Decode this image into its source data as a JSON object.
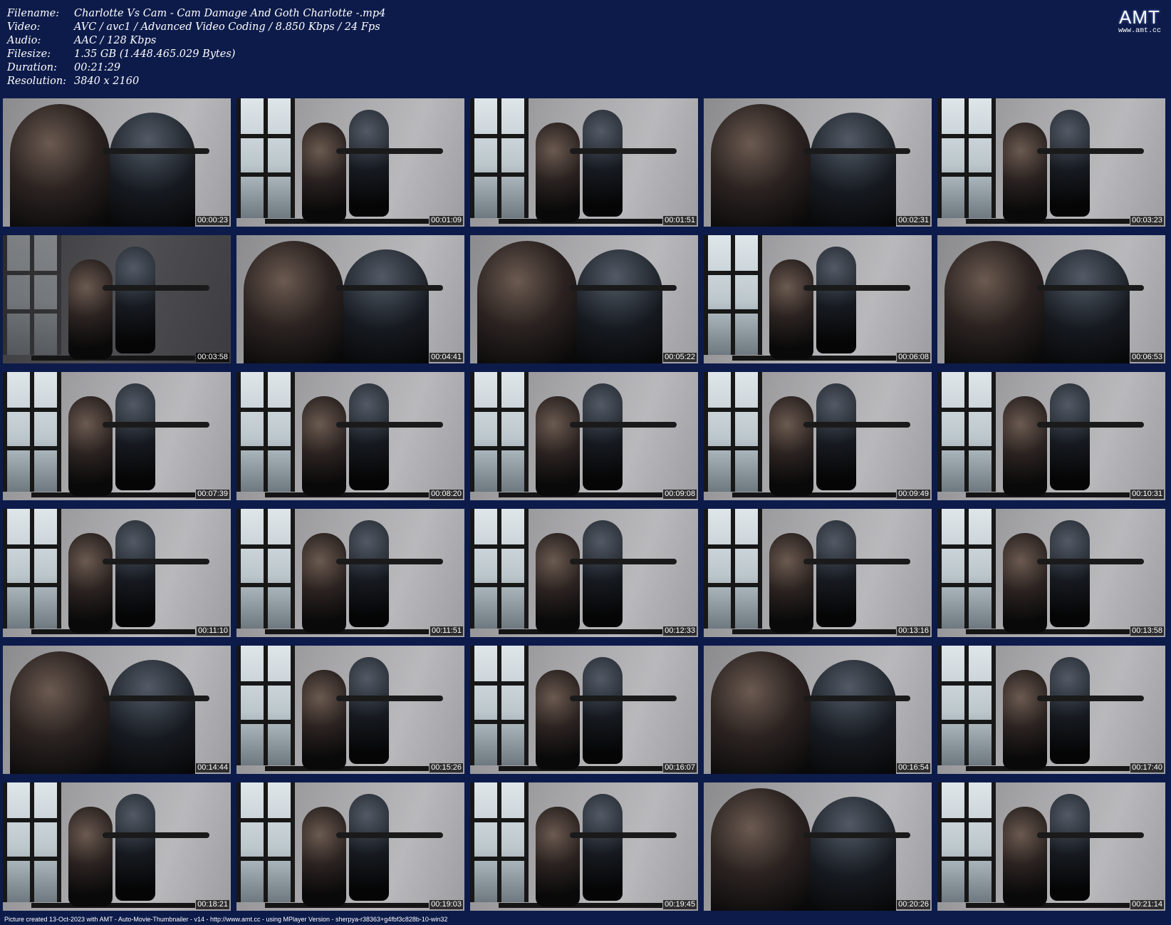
{
  "info": [
    {
      "key": "Filename:",
      "value": "Charlotte Vs Cam - Cam Damage And Goth Charlotte -.mp4"
    },
    {
      "key": "Video:",
      "value": "AVC / avc1 / Advanced Video Coding / 8.850 Kbps / 24 Fps"
    },
    {
      "key": "Audio:",
      "value": "AAC / 128 Kbps"
    },
    {
      "key": "Filesize:",
      "value": "1.35 GB (1.448.465.029 Bytes)"
    },
    {
      "key": "Duration:",
      "value": "00:21:29"
    },
    {
      "key": "Resolution:",
      "value": "3840 x 2160"
    }
  ],
  "logo": {
    "main": "AMT",
    "sub": "www.amt.cc"
  },
  "thumbnails": [
    {
      "time": "00:00:23",
      "style": "closeup"
    },
    {
      "time": "00:01:09",
      "style": "wide"
    },
    {
      "time": "00:01:51",
      "style": "wide"
    },
    {
      "time": "00:02:31",
      "style": "closeup"
    },
    {
      "time": "00:03:23",
      "style": "wide"
    },
    {
      "time": "00:03:58",
      "style": "dark"
    },
    {
      "time": "00:04:41",
      "style": "closeup"
    },
    {
      "time": "00:05:22",
      "style": "closeup"
    },
    {
      "time": "00:06:08",
      "style": "wide"
    },
    {
      "time": "00:06:53",
      "style": "closeup"
    },
    {
      "time": "00:07:39",
      "style": "wide"
    },
    {
      "time": "00:08:20",
      "style": "wide"
    },
    {
      "time": "00:09:08",
      "style": "wide"
    },
    {
      "time": "00:09:49",
      "style": "wide"
    },
    {
      "time": "00:10:31",
      "style": "wide"
    },
    {
      "time": "00:11:10",
      "style": "wide"
    },
    {
      "time": "00:11:51",
      "style": "wide"
    },
    {
      "time": "00:12:33",
      "style": "wide"
    },
    {
      "time": "00:13:16",
      "style": "wide"
    },
    {
      "time": "00:13:58",
      "style": "wide"
    },
    {
      "time": "00:14:44",
      "style": "closeup"
    },
    {
      "time": "00:15:26",
      "style": "wide"
    },
    {
      "time": "00:16:07",
      "style": "wide"
    },
    {
      "time": "00:16:54",
      "style": "closeup"
    },
    {
      "time": "00:17:40",
      "style": "wide"
    },
    {
      "time": "00:18:21",
      "style": "wide"
    },
    {
      "time": "00:19:03",
      "style": "wide"
    },
    {
      "time": "00:19:45",
      "style": "wide"
    },
    {
      "time": "00:20:26",
      "style": "closeup"
    },
    {
      "time": "00:21:14",
      "style": "wide"
    }
  ],
  "footer": "Picture created 13-Oct-2023 with AMT - Auto-Movie-Thumbnailer - v14 - http://www.amt.cc - using MPlayer Version - sherpya-r38363+g4fbf3c828b-10-win32"
}
